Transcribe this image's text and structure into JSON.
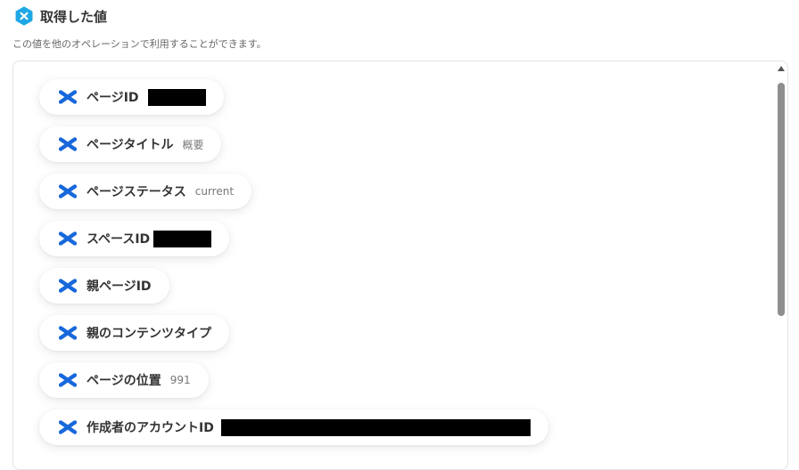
{
  "section": {
    "title": "取得した値",
    "description": "この値を他のオペレーションで利用することができます。"
  },
  "items": [
    {
      "label": "ページID",
      "value": ""
    },
    {
      "label": "ページタイトル",
      "value": "概要"
    },
    {
      "label": "ページステータス",
      "value": "current"
    },
    {
      "label": "スペースID",
      "value": ""
    },
    {
      "label": "親ページID",
      "value": ""
    },
    {
      "label": "親のコンテンツタイプ",
      "value": ""
    },
    {
      "label": "ページの位置",
      "value": "991"
    },
    {
      "label": "作成者のアカウントID",
      "value": ""
    }
  ],
  "icons": {
    "header": "hexagon-x-icon",
    "item": "confluence-icon"
  },
  "colors": {
    "header_icon": "#1ea7e4",
    "item_icon": "#1868db",
    "redaction": "#000000"
  }
}
